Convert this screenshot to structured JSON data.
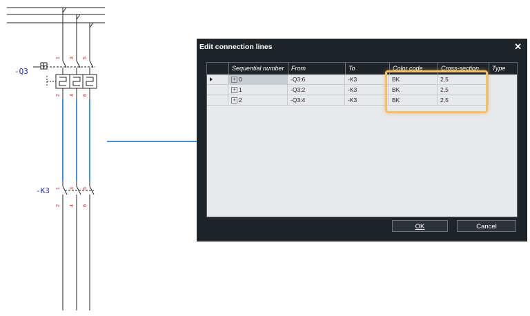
{
  "schematic": {
    "q3_label": "-Q3",
    "k3_label": "-K3",
    "q3_top_pins": [
      "1",
      "3",
      "5"
    ],
    "q3_bottom_pins": [
      "2",
      "4",
      "6"
    ],
    "k3_top_pins": [
      "1",
      "3",
      "5"
    ],
    "k3_bottom_pins": [
      "2",
      "4",
      "6"
    ]
  },
  "dialog": {
    "title": "Edit connection lines",
    "close_glyph": "✕",
    "columns": [
      "Sequential number",
      "From",
      "To",
      "Color code",
      "Cross-section",
      "Type"
    ],
    "rows": [
      {
        "seq": "0",
        "from": "-Q3:6",
        "to": "-K3",
        "color": "BK",
        "cross": "2,5",
        "type": ""
      },
      {
        "seq": "1",
        "from": "-Q3:2",
        "to": "-K3",
        "color": "BK",
        "cross": "2,5",
        "type": ""
      },
      {
        "seq": "2",
        "from": "-Q3:4",
        "to": "-K3",
        "color": "BK",
        "cross": "2,5",
        "type": ""
      }
    ],
    "ok_label": "OK",
    "cancel_label": "Cancel",
    "expand_glyph": "+",
    "row_pointer": "current-row-icon"
  },
  "colors": {
    "wire_highlight": "#4a90d9",
    "callout_highlight": "#f4c067",
    "dialog_bg": "#1f2429"
  }
}
